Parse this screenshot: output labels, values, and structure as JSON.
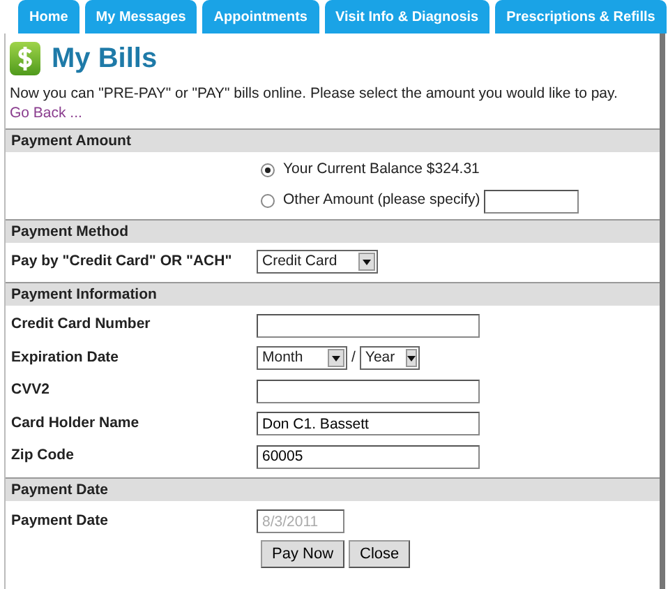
{
  "tabs": [
    {
      "label": "Home",
      "selected": false
    },
    {
      "label": "My Messages",
      "selected": false
    },
    {
      "label": "Appointments",
      "selected": false
    },
    {
      "label": "Visit Info & Diagnosis",
      "selected": false
    },
    {
      "label": "Prescriptions & Refills",
      "selected": false
    }
  ],
  "page_title": "My Bills",
  "intro": "Now you can \"PRE-PAY\" or \"PAY\" bills online. Please select the amount you would like to pay.",
  "back_link": "Go Back ...",
  "sections": [
    {
      "title": "Payment Amount",
      "rows": [
        {
          "kind": "radio",
          "label": "Your Current Balance $324.31",
          "selected": true
        },
        {
          "kind": "radio",
          "label": "Other Amount (please specify)",
          "selected": false,
          "has_field": true
        }
      ]
    },
    {
      "title": "Payment Method",
      "rows": [
        {
          "kind": "select",
          "label": "Pay by \"Credit Card\" OR \"ACH\"",
          "value": "Credit Card"
        }
      ]
    },
    {
      "title": "Payment Information",
      "rows": [
        {
          "kind": "text",
          "label": "Credit Card Number"
        },
        {
          "kind": "expiry",
          "label": "Expiration Date",
          "month": "Month",
          "separator": "/",
          "year": "Year"
        },
        {
          "kind": "text",
          "label": "CVV2"
        },
        {
          "kind": "text",
          "label": "Card Holder Name",
          "value": "Don C1. Bassett"
        },
        {
          "kind": "text",
          "label": "Zip Code",
          "value": "60005"
        }
      ]
    },
    {
      "title": "Payment Date",
      "rows": [
        {
          "kind": "text",
          "label": "Payment Date",
          "value": "8/3/2011",
          "disabled": true,
          "short": true
        },
        {
          "kind": "buttons",
          "buttons": [
            "Pay Now",
            "Close"
          ]
        }
      ]
    }
  ]
}
